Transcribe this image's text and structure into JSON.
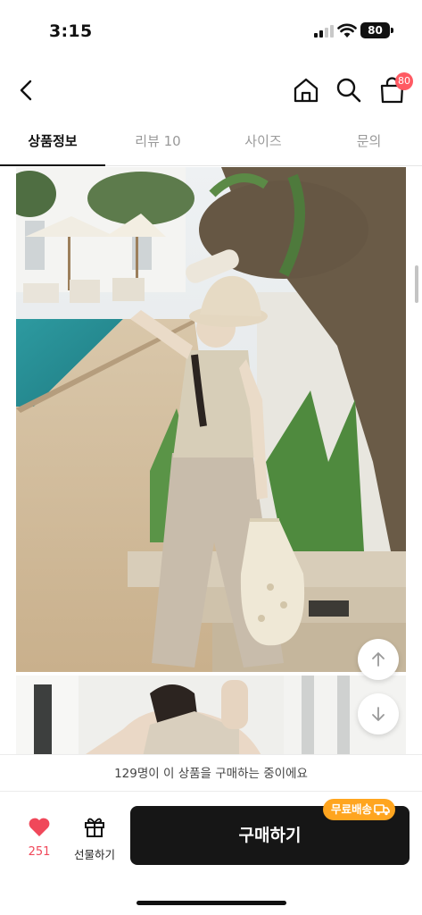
{
  "status_bar": {
    "time": "3:15",
    "battery": "80"
  },
  "nav": {
    "back_icon": "chevron-left-icon",
    "home_icon": "home-icon",
    "search_icon": "search-icon",
    "cart_icon": "shopping-bag-icon",
    "cart_badge": "80"
  },
  "tabs": [
    {
      "label": "상품정보",
      "active": true
    },
    {
      "label": "리뷰 10",
      "active": false
    },
    {
      "label": "사이즈",
      "active": false
    },
    {
      "label": "문의",
      "active": false
    }
  ],
  "content": {
    "scroll_up_icon": "arrow-up-icon",
    "scroll_down_icon": "arrow-down-icon"
  },
  "purchase_notice": "129명이 이 상품을 구매하는 중이에요",
  "bottom_bar": {
    "like_icon": "heart-icon",
    "like_count": "251",
    "gift_icon": "gift-icon",
    "gift_label": "선물하기",
    "buy_label": "구매하기",
    "free_shipping_label": "무료배송",
    "free_shipping_icon": "truck-icon"
  },
  "colors": {
    "accent_red": "#f0485a",
    "badge_red": "#ff5a63",
    "free_ship_orange": "#ffa51f",
    "buy_button": "#161616"
  }
}
